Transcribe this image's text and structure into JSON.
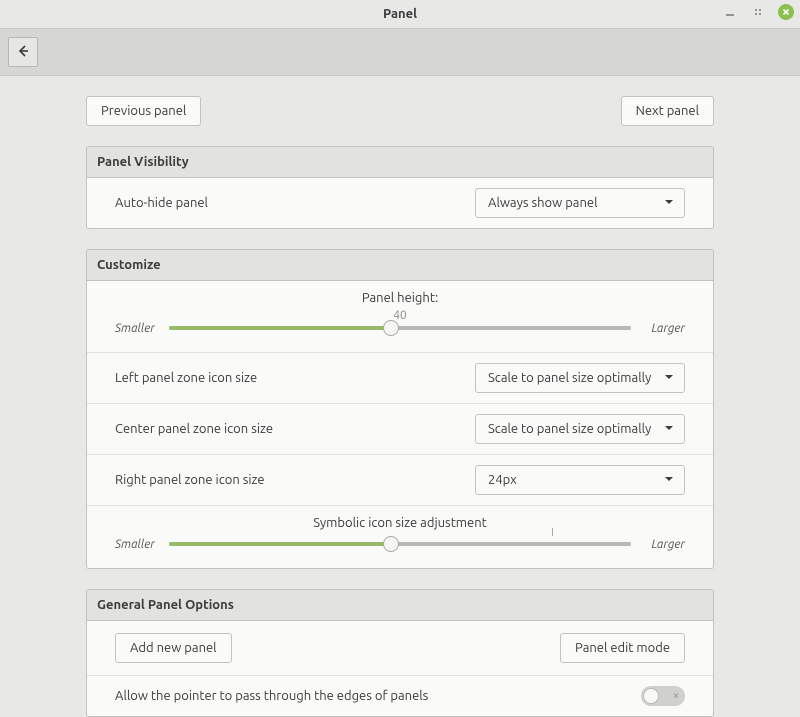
{
  "window": {
    "title": "Panel"
  },
  "nav": {
    "previous": "Previous panel",
    "next": "Next panel"
  },
  "visibility": {
    "header": "Panel Visibility",
    "autohide_label": "Auto-hide panel",
    "autohide_value": "Always show panel"
  },
  "customize": {
    "header": "Customize",
    "height_title": "Panel height:",
    "height_value": "40",
    "height_percent": 48,
    "smaller": "Smaller",
    "larger": "Larger",
    "left_label": "Left panel zone icon size",
    "left_value": "Scale to panel size optimally",
    "center_label": "Center panel zone icon size",
    "center_value": "Scale to panel size optimally",
    "right_label": "Right panel zone icon size",
    "right_value": "24px",
    "symbolic_title": "Symbolic icon size adjustment",
    "symbolic_percent": 48
  },
  "general": {
    "header": "General Panel Options",
    "add_panel": "Add new panel",
    "edit_mode": "Panel edit mode",
    "pointer_label": "Allow the pointer to pass through the edges of panels",
    "pointer_on": false
  }
}
